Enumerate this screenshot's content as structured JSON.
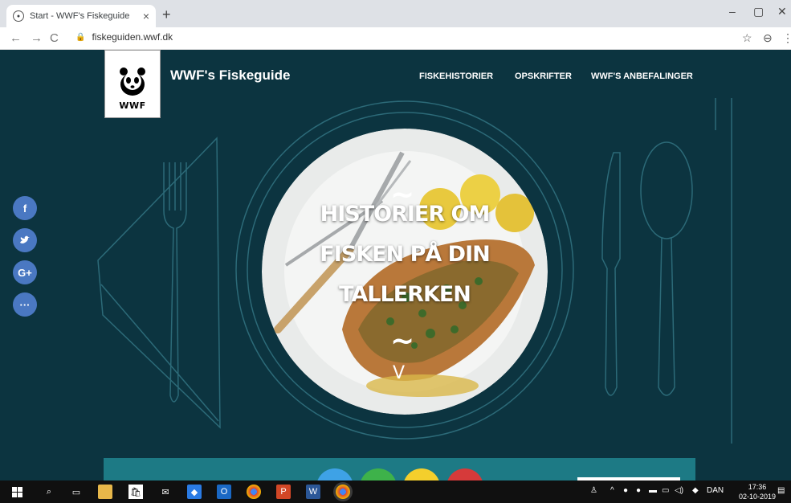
{
  "browser": {
    "tab_title": "Start - WWF's Fiskeguide",
    "tab_close": "×",
    "new_tab": "+",
    "url": "fiskeguiden.wwf.dk",
    "back": "←",
    "forward": "→",
    "reload": "C",
    "star": "☆",
    "profile": "⊖",
    "menu": "⋮",
    "minimize": "–",
    "restore": "▢",
    "close": "✕"
  },
  "site": {
    "logo_text": "WWF",
    "brand": "WWF's Fiskeguide",
    "nav": [
      "FISKEHISTORIER",
      "OPSKRIFTER",
      "WWF'S ANBEFALINGER"
    ],
    "hero_lines": [
      "HISTORIER OM",
      "FISKEN PÅ DIN",
      "TALLERKEN"
    ],
    "tilde": "~",
    "scroll_chevron": "V",
    "social": {
      "facebook": "f",
      "twitter": "t",
      "google_plus": "G+",
      "more": "···"
    }
  },
  "colors": {
    "page_bg": "#0c3440",
    "line": "#2c6a78",
    "social": "#4a78c2",
    "bar": "#1d7a85",
    "circle_blue": "#3ea2e6",
    "circle_green": "#3eb24a",
    "circle_yellow": "#f4cf2c",
    "circle_red": "#d63a3a"
  },
  "taskbar": {
    "lang": "DAN",
    "time": "17:36",
    "date": "02-10-2019",
    "icons": [
      "windows-icon",
      "search-icon",
      "task-view-icon",
      "file-explorer-icon",
      "store-icon",
      "mail-icon",
      "dropbox-icon",
      "outlook-icon",
      "chrome-icon",
      "powerpoint-icon",
      "word-icon",
      "chrome-active-icon"
    ]
  }
}
